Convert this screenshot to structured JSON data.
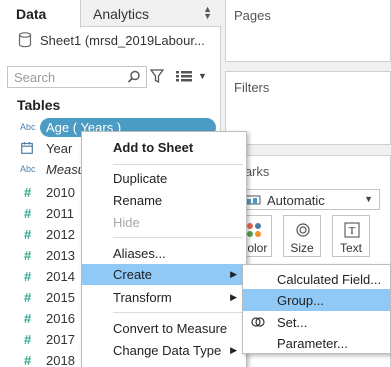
{
  "tabs": {
    "data": "Data",
    "analytics": "Analytics"
  },
  "datasource": {
    "name": "Sheet1 (mrsd_2019Labour..."
  },
  "search": {
    "placeholder": "Search"
  },
  "tables": {
    "heading": "Tables",
    "fields": [
      {
        "type": "Abc",
        "name": "Age ( Years )"
      },
      {
        "type": "date",
        "name": "Year"
      },
      {
        "type": "Abc",
        "name": "Measure Names"
      },
      {
        "type": "#",
        "name": "2010"
      },
      {
        "type": "#",
        "name": "2011"
      },
      {
        "type": "#",
        "name": "2012"
      },
      {
        "type": "#",
        "name": "2013"
      },
      {
        "type": "#",
        "name": "2014"
      },
      {
        "type": "#",
        "name": "2015"
      },
      {
        "type": "#",
        "name": "2016"
      },
      {
        "type": "#",
        "name": "2017"
      },
      {
        "type": "#",
        "name": "2018"
      }
    ]
  },
  "panels": {
    "pages": "Pages",
    "filters": "Filters",
    "marks": "Marks",
    "marks_type": "Automatic",
    "color_label": "Color",
    "size_label": "Size",
    "text_label": "Text"
  },
  "context_menu": {
    "items": [
      {
        "label": "Add to Sheet",
        "bold": true
      },
      {
        "label": "Duplicate"
      },
      {
        "label": "Rename"
      },
      {
        "label": "Hide",
        "disabled": true
      },
      {
        "label": "Aliases..."
      },
      {
        "label": "Create",
        "submenu": true,
        "highlighted": true
      },
      {
        "label": "Transform",
        "submenu": true
      },
      {
        "label": "Convert to Measure"
      },
      {
        "label": "Change Data Type",
        "submenu": true
      }
    ]
  },
  "submenu": {
    "items": [
      {
        "label": "Calculated Field..."
      },
      {
        "label": "Group...",
        "highlighted": true
      },
      {
        "label": "Set...",
        "icon": "set-icon"
      },
      {
        "label": "Parameter..."
      }
    ]
  },
  "colors": {
    "pill": "#4b9cc4",
    "highlight": "#90c8f6",
    "measure_green": "#2ea58c",
    "dimension_blue": "#4f7fa8"
  }
}
